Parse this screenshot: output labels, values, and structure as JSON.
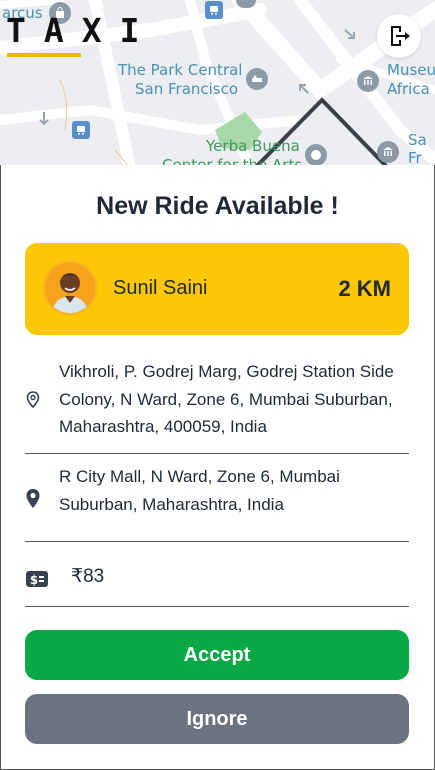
{
  "map": {
    "labels": {
      "arcus": "arcus",
      "park_central_line1": "The Park Central",
      "park_central_line2": "San Francisco",
      "museum_line1": "Museu",
      "museum_line2": "Africa",
      "yerba_line1": "Yerba Buena",
      "yerba_line2": "Center for the Arts",
      "sf_line1": "Sa",
      "sf_line2": "Fr"
    }
  },
  "app": {
    "logo_text": "TAXI"
  },
  "ride": {
    "heading": "New Ride Available !",
    "rider_name": "Sunil Saini",
    "distance": "2 KM",
    "pickup": "Vikhroli, P. Godrej Marg, Godrej Station Side Colony, N Ward, Zone 6, Mumbai Suburban, Maharashtra, 400059, India",
    "drop": "R City Mall, N Ward, Zone 6, Mumbai Suburban, Maharashtra, India",
    "fare": "₹83"
  },
  "actions": {
    "accept_label": "Accept",
    "ignore_label": "Ignore"
  },
  "colors": {
    "brand_yellow": "#fcc705",
    "accept_green": "#08a944",
    "ignore_gray": "#6b7280"
  },
  "icons": {
    "logout": "logout-icon",
    "pickup": "map-pin-outline-icon",
    "drop": "map-pin-solid-icon",
    "fare": "cash-icon"
  }
}
